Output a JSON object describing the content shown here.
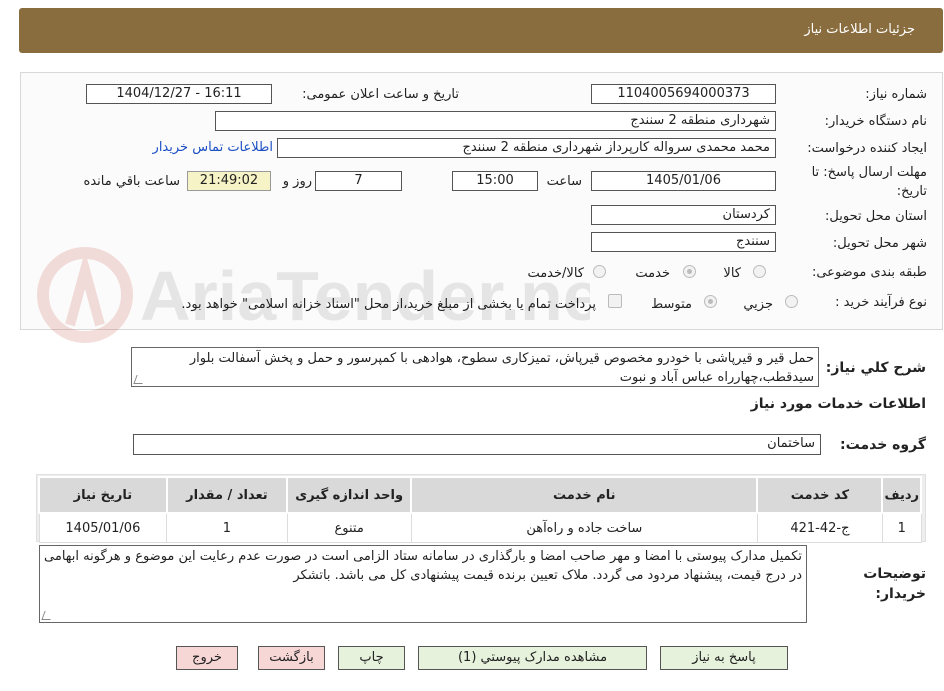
{
  "header": {
    "title": "جزئیات اطلاعات نیاز"
  },
  "form": {
    "need_number_label": "شماره نیاز:",
    "need_number": "1104005694000373",
    "announce_label": "تاریخ و ساعت اعلان عمومی:",
    "announce_value": "1404/12/27 - 16:11",
    "buyer_label": "نام دستگاه خریدار:",
    "buyer_value": "شهرداری منطقه 2 سنندج",
    "creator_label": "ایجاد کننده درخواست:",
    "creator_value": "محمد محمدی سرواله کارپرداز شهرداری منطقه 2 سنندج",
    "contact_link": "اطلاعات تماس خریدار",
    "deadline_label_1": "مهلت ارسال پاسخ: تا",
    "deadline_label_2": "تاریخ:",
    "deadline_date": "1405/01/06",
    "time_label": "ساعت",
    "deadline_time": "15:00",
    "days_value": "7",
    "days_label": "روز و",
    "remaining_time": "21:49:02",
    "remaining_label": "ساعت باقي مانده",
    "province_label": "استان محل تحویل:",
    "province_value": "کردستان",
    "city_label": "شهر محل تحویل:",
    "city_value": "سنندج",
    "category_label": "طبقه بندی موضوعی:",
    "category_options": [
      "کالا",
      "خدمت",
      "کالا/خدمت"
    ],
    "process_label": "نوع فرآیند خرید :",
    "process_options": [
      "جزیي",
      "متوسط"
    ],
    "treasury_note": "پرداخت تمام یا بخشی از مبلغ خرید،از محل \"اسناد خزانه اسلامی\" خواهد بود."
  },
  "description": {
    "label": "شرح کلي نیاز:",
    "text": "حمل قیر و قیرپاشی با خودرو مخصوص قیرپاش، تمیزکاری سطوح، هوادهی با کمپرسور و حمل و پخش آسفالت بلوار سیدقطب،چهارراه عباس آباد و نبوت"
  },
  "services": {
    "section_title": "اطلاعات خدمات مورد نیاز",
    "group_label": "گروه خدمت:",
    "group_value": "ساختمان",
    "columns": [
      "ردیف",
      "کد خدمت",
      "نام خدمت",
      "واحد اندازه گیری",
      "تعداد / مقدار",
      "تاریخ نیاز"
    ],
    "rows": [
      [
        "1",
        "ج-42-421",
        "ساخت جاده و راه‌آهن",
        "متنوع",
        "1",
        "1405/01/06"
      ]
    ]
  },
  "buyer_notes": {
    "label_1": "توضیحات",
    "label_2": "خریدار:",
    "text": "تکمیل مدارک پیوستی با امضا و مهر صاحب امضا و بارگذاری در سامانه ستاد الزامی است در صورت عدم رعایت این موضوع و هرگونه ابهامی در درج قیمت، پیشنهاد مردود می گردد. ملاک تعیین برنده قیمت پیشنهادی کل می باشد. باتشکر"
  },
  "buttons": {
    "reply": "پاسخ به نیاز",
    "attachments": "مشاهده مدارک پیوستي (1)",
    "print": "چاپ",
    "back": "بازگشت",
    "exit": "خروج"
  },
  "watermark": {
    "text": "AriaTender.neT"
  },
  "colors": {
    "header": "#8a6d3e",
    "button": "#e6f2dc",
    "button_pink": "#f7d6d6",
    "timer": "#f6f3c6",
    "link": "#1a4fc4"
  }
}
